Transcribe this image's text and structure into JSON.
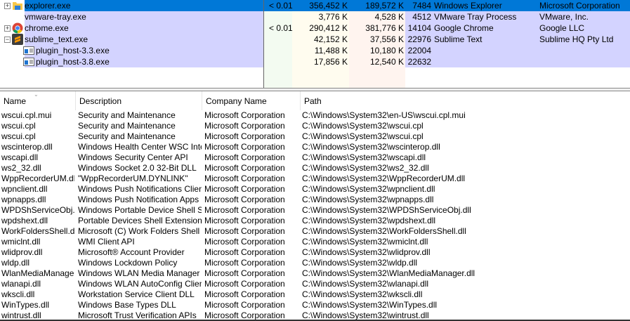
{
  "colors": {
    "selection": "#0078d7",
    "own_process": "#d3d3ff"
  },
  "processes": [
    {
      "name": "explorer.exe",
      "icon": "explorer-folder-icon",
      "expander": "+",
      "cpu": "< 0.01",
      "private_bytes": "356,452 K",
      "working_set": "189,572 K",
      "pid": "7484",
      "description": "Windows Explorer",
      "company": "Microsoft Corporation",
      "selected": true
    },
    {
      "name": "vmware-tray.exe",
      "icon": "",
      "expander": "",
      "cpu": "",
      "private_bytes": "3,776 K",
      "working_set": "4,528 K",
      "pid": "4512",
      "description": "VMware Tray Process",
      "company": "VMware, Inc."
    },
    {
      "name": "chrome.exe",
      "icon": "chrome-icon",
      "expander": "+",
      "cpu": "< 0.01",
      "private_bytes": "290,412 K",
      "working_set": "381,776 K",
      "pid": "14104",
      "description": "Google Chrome",
      "company": "Google LLC"
    },
    {
      "name": "sublime_text.exe",
      "icon": "sublime-text-icon",
      "expander": "−",
      "cpu": "",
      "private_bytes": "42,152 K",
      "working_set": "37,556 K",
      "pid": "22976",
      "description": "Sublime Text",
      "company": "Sublime HQ Pty Ltd"
    },
    {
      "name": "plugin_host-3.3.exe",
      "icon": "window-app-icon",
      "expander": "",
      "cpu": "",
      "private_bytes": "11,488 K",
      "working_set": "10,180 K",
      "pid": "22004",
      "description": "",
      "company": "",
      "child": true
    },
    {
      "name": "plugin_host-3.8.exe",
      "icon": "window-app-icon",
      "expander": "",
      "cpu": "",
      "private_bytes": "17,856 K",
      "working_set": "12,540 K",
      "pid": "22632",
      "description": "",
      "company": "",
      "child": true
    }
  ],
  "dll_columns": [
    "Name",
    "Description",
    "Company Name",
    "Path"
  ],
  "dlls": [
    [
      "wscui.cpl.mui",
      "Security and Maintenance",
      "Microsoft Corporation",
      "C:\\Windows\\System32\\en-US\\wscui.cpl.mui"
    ],
    [
      "wscui.cpl",
      "Security and Maintenance",
      "Microsoft Corporation",
      "C:\\Windows\\System32\\wscui.cpl"
    ],
    [
      "wscui.cpl",
      "Security and Maintenance",
      "Microsoft Corporation",
      "C:\\Windows\\System32\\wscui.cpl"
    ],
    [
      "wscinterop.dll",
      "Windows Health Center WSC Inter...",
      "Microsoft Corporation",
      "C:\\Windows\\System32\\wscinterop.dll"
    ],
    [
      "wscapi.dll",
      "Windows Security Center API",
      "Microsoft Corporation",
      "C:\\Windows\\System32\\wscapi.dll"
    ],
    [
      "ws2_32.dll",
      "Windows Socket 2.0 32-Bit DLL",
      "Microsoft Corporation",
      "C:\\Windows\\System32\\ws2_32.dll"
    ],
    [
      "WppRecorderUM.dll",
      "\"WppRecorderUM.DYNLINK\"",
      "Microsoft Corporation",
      "C:\\Windows\\System32\\WppRecorderUM.dll"
    ],
    [
      "wpnclient.dll",
      "Windows Push Notifications Client",
      "Microsoft Corporation",
      "C:\\Windows\\System32\\wpnclient.dll"
    ],
    [
      "wpnapps.dll",
      "Windows Push Notification Apps",
      "Microsoft Corporation",
      "C:\\Windows\\System32\\wpnapps.dll"
    ],
    [
      "WPDShServiceObj.dll",
      "Windows Portable Device Shell Se...",
      "Microsoft Corporation",
      "C:\\Windows\\System32\\WPDShServiceObj.dll"
    ],
    [
      "wpdshext.dll",
      "Portable Devices Shell Extension",
      "Microsoft Corporation",
      "C:\\Windows\\System32\\wpdshext.dll"
    ],
    [
      "WorkFoldersShell.dll",
      "Microsoft (C) Work Folders Shell E...",
      "Microsoft Corporation",
      "C:\\Windows\\System32\\WorkFoldersShell.dll"
    ],
    [
      "wmiclnt.dll",
      "WMI Client API",
      "Microsoft Corporation",
      "C:\\Windows\\System32\\wmiclnt.dll"
    ],
    [
      "wlidprov.dll",
      "Microsoft® Account Provider",
      "Microsoft Corporation",
      "C:\\Windows\\System32\\wlidprov.dll"
    ],
    [
      "wldp.dll",
      "Windows Lockdown Policy",
      "Microsoft Corporation",
      "C:\\Windows\\System32\\wldp.dll"
    ],
    [
      "WlanMediaManage...",
      "Windows WLAN Media Manager ...",
      "Microsoft Corporation",
      "C:\\Windows\\System32\\WlanMediaManager.dll"
    ],
    [
      "wlanapi.dll",
      "Windows WLAN AutoConfig Client...",
      "Microsoft Corporation",
      "C:\\Windows\\System32\\wlanapi.dll"
    ],
    [
      "wkscli.dll",
      "Workstation Service Client DLL",
      "Microsoft Corporation",
      "C:\\Windows\\System32\\wkscli.dll"
    ],
    [
      "WinTypes.dll",
      "Windows Base Types DLL",
      "Microsoft Corporation",
      "C:\\Windows\\System32\\WinTypes.dll"
    ],
    [
      "wintrust.dll",
      "Microsoft Trust Verification APIs",
      "Microsoft Corporation",
      "C:\\Windows\\System32\\wintrust.dll"
    ]
  ]
}
